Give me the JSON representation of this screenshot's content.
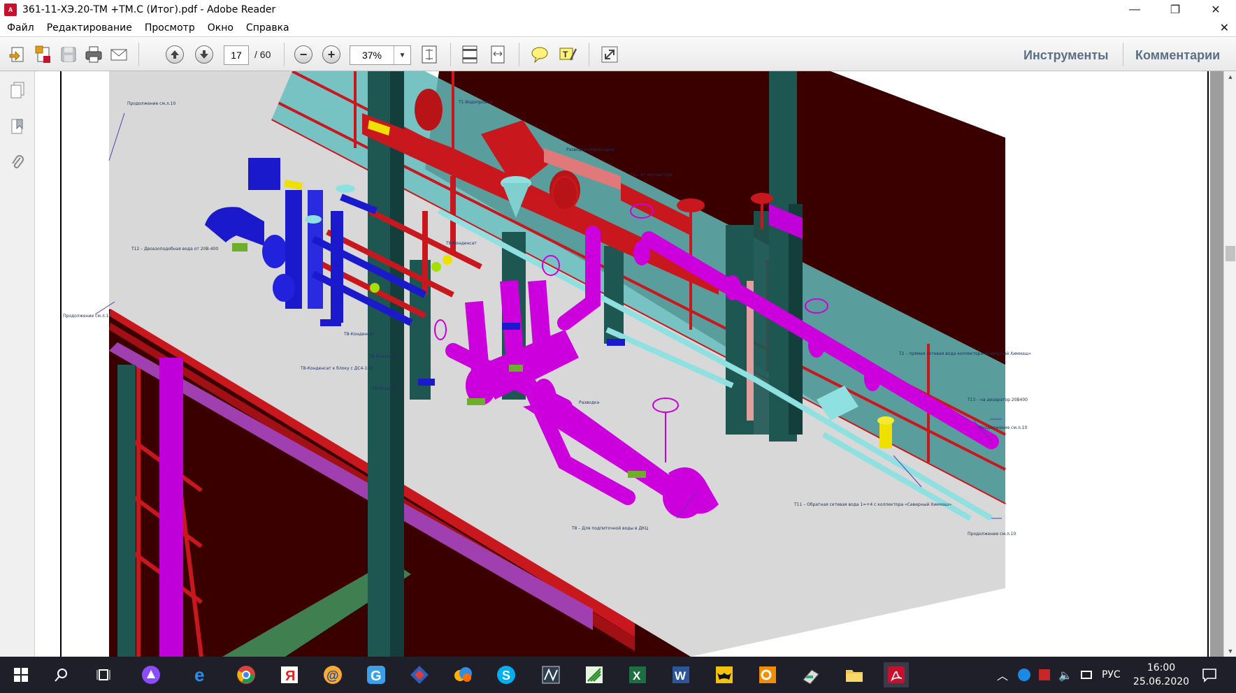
{
  "window": {
    "title": "361-11-ХЭ.20-ТМ +ТМ.С (Итог).pdf - Adobe Reader",
    "minimize": "—",
    "restore": "❐",
    "close": "✕",
    "doc_close": "✕"
  },
  "menu": [
    "Файл",
    "Редактирование",
    "Просмотр",
    "Окно",
    "Справка"
  ],
  "toolbar": {
    "page_current": "17",
    "page_total": "/ 60",
    "zoom": "37%",
    "tools_label": "Инструменты",
    "comments_label": "Комментарии"
  },
  "drawing": {
    "labels": [
      {
        "id": "l1",
        "text": "Продолжение см.л.10"
      },
      {
        "id": "l2",
        "text": "Продолжение см.л.10"
      },
      {
        "id": "l3",
        "text": "Т12 – Двоазоподобная вода от 20В-400"
      },
      {
        "id": "l4",
        "text": "Т8-Конденсат"
      },
      {
        "id": "l5",
        "text": "Т8-Конденсат"
      },
      {
        "id": "l6",
        "text": "Т8-Конденсат"
      },
      {
        "id": "l7",
        "text": "Т8-Конденсат к блоку с ДС4-108"
      },
      {
        "id": "l8",
        "text": "Т8-Конденсат"
      },
      {
        "id": "l9",
        "text": "Т1-Водопровод"
      },
      {
        "id": "l10",
        "text": "Разводка (переходка)"
      },
      {
        "id": "l11",
        "text": "Т1 – от коллектора"
      },
      {
        "id": "l12",
        "text": "Т2 – прямая сетевая вода коллектора «Северный Химмаш»"
      },
      {
        "id": "l13",
        "text": "Т13 – на деаэратор 20В400"
      },
      {
        "id": "l14",
        "text": "Продолжение см.л.10"
      },
      {
        "id": "l15",
        "text": "Т11 – Обратная сетевая вода 1=+4 с коллектора «Северный Химмаш»"
      },
      {
        "id": "l16",
        "text": "Продолжение см.л.10"
      },
      {
        "id": "l17",
        "text": "Т8 – Для подпиточной воды в ДКЦ"
      },
      {
        "id": "l18",
        "text": "Разводка"
      }
    ]
  },
  "taskbar": {
    "lang": "РУС",
    "time": "16:00",
    "date": "25.06.2020"
  },
  "colors": {
    "steel_red": "#c8181e",
    "column_green": "#1e5652",
    "pipe_magenta": "#cc00dd",
    "pipe_cyan": "#8fe0e0",
    "pipe_blue": "#1a1acc",
    "wall_teal": "#5fb8b8",
    "dark_red_bg": "#3a0000",
    "floor_grey": "#d8d8d8"
  }
}
